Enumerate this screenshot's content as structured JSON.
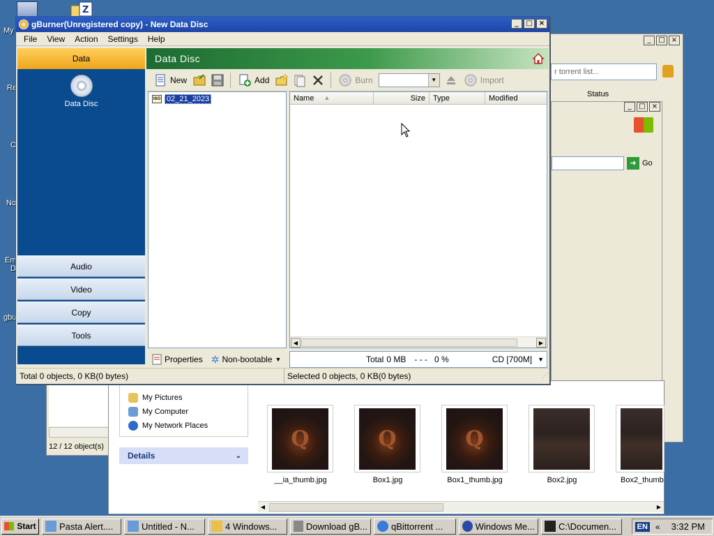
{
  "desktop": {
    "labels": [
      "My",
      "Re",
      "C",
      "No",
      "Em",
      "D",
      "gbu"
    ]
  },
  "explorer": {
    "tasks": [
      "My Pictures",
      "My Computer",
      "My Network Places"
    ],
    "details_label": "Details",
    "thumbnails": [
      "__ia_thumb.jpg",
      "Box1.jpg",
      "Box1_thumb.jpg",
      "Box2.jpg",
      "Box2_thumb"
    ]
  },
  "left_window": {
    "status": "12 / 12 object(s)"
  },
  "torrent": {
    "search_placeholder": "r torrent list...",
    "status_col": "Status",
    "go_label": "Go"
  },
  "gburner": {
    "title": "gBurner(Unregistered copy) - New Data Disc",
    "menu": [
      "File",
      "View",
      "Action",
      "Settings",
      "Help"
    ],
    "nav": {
      "data": "Data",
      "data_disc": "Data Disc",
      "audio": "Audio",
      "video": "Video",
      "copy": "Copy",
      "tools": "Tools"
    },
    "header_title": "Data Disc",
    "toolbar": {
      "new": "New",
      "add": "Add",
      "burn": "Burn",
      "import": "Import"
    },
    "tree_item": "02_21_2023",
    "columns": [
      "Name",
      "Size",
      "Type",
      "Modified"
    ],
    "properties_label": "Properties",
    "bootable_label": "Non-bootable",
    "total_label": "Total",
    "total_value": "0 MB",
    "percent": "- - -   0 %",
    "disc_type": "CD [700M]",
    "status_left": "Total 0 objects, 0 KB(0 bytes)",
    "status_right": "Selected 0 objects, 0 KB(0 bytes)"
  },
  "taskbar": {
    "start": "Start",
    "items": [
      "Pasta Alert....",
      "Untitled - N...",
      "4 Windows...",
      "Download gB...",
      "qBittorrent ...",
      "Windows Me...",
      "C:\\Documen..."
    ],
    "lang": "EN",
    "time": "3:32 PM"
  },
  "colors": {
    "desktop": "#3a6ea5",
    "title_bar": "#1d46a6",
    "nav_blue": "#0a4a8e",
    "nav_active": "#f0a41a",
    "header_green": "#1d6b32"
  }
}
